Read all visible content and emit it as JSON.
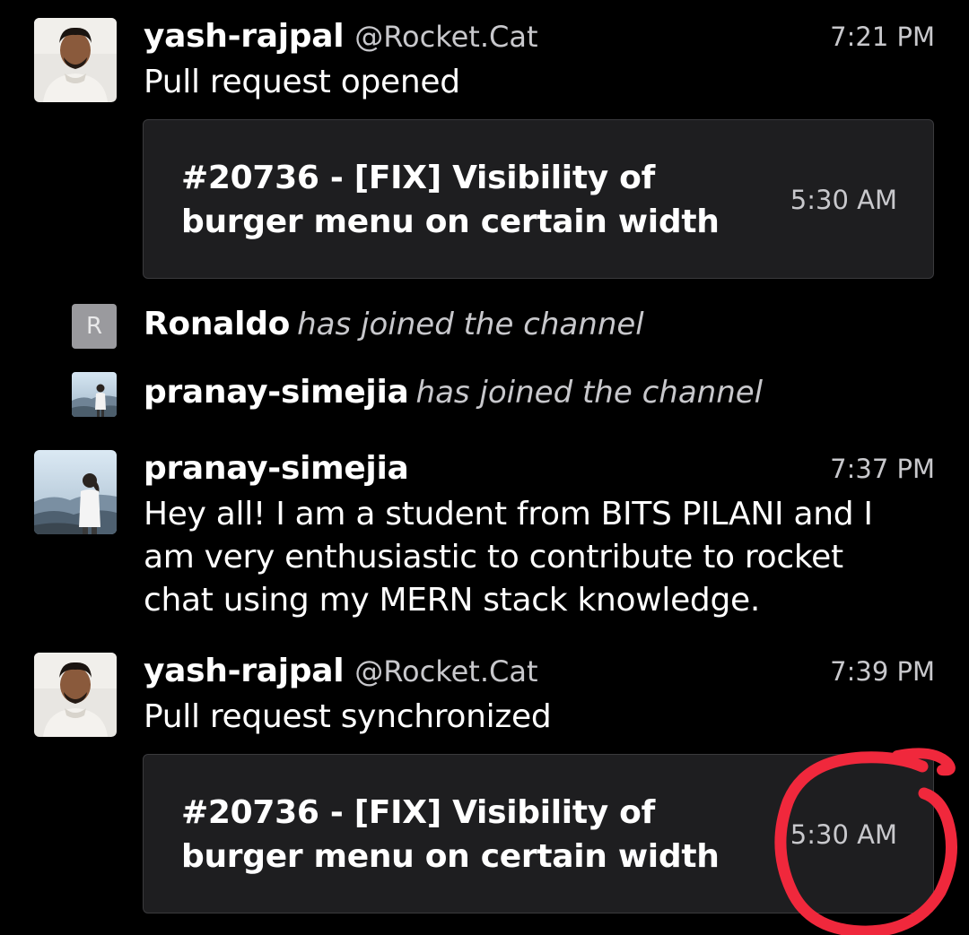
{
  "messages": [
    {
      "user": "yash-rajpal",
      "alias": "@Rocket.Cat",
      "time": "7:21 PM",
      "text": "Pull request opened",
      "attachment": {
        "title": "#20736 - [FIX] Visibility of burger menu on certain width",
        "time": "5:30 AM"
      }
    },
    {
      "user": "pranay-simejia",
      "time": "7:37 PM",
      "text": "Hey all! I am a student from BITS PILANI and I am very enthusiastic to contribute to rocket chat using my MERN stack knowledge."
    },
    {
      "user": "yash-rajpal",
      "alias": "@Rocket.Cat",
      "time": "7:39 PM",
      "text": "Pull request synchronized",
      "attachment": {
        "title": "#20736 - [FIX] Visibility of burger menu on certain width",
        "time": "5:30 AM"
      }
    }
  ],
  "system_messages": [
    {
      "user": "Ronaldo",
      "text": "has joined the channel",
      "avatar_letter": "R"
    },
    {
      "user": "pranay-simejia",
      "text": "has joined the channel"
    }
  ],
  "colors": {
    "background": "#000000",
    "attachment_bg": "#1e1e20",
    "muted_text": "#c8c8cc",
    "annotation": "#f0283c"
  },
  "icons": {
    "avatar_yash": "person-photo-avatar",
    "avatar_pranay": "mountain-photo-avatar",
    "avatar_ronaldo": "letter-avatar"
  }
}
